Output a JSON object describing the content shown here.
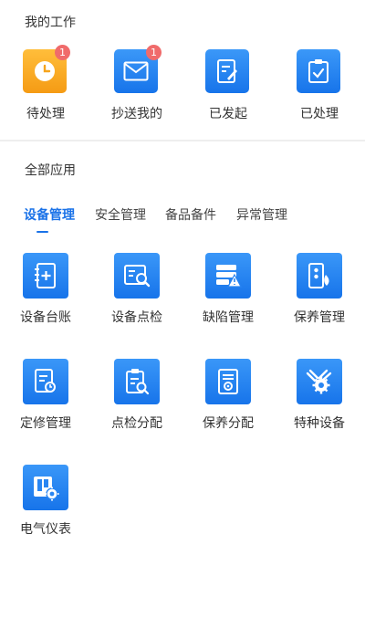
{
  "my_work": {
    "title": "我的工作",
    "items": [
      {
        "label": "待处理",
        "badge": "1",
        "icon": "clock-icon",
        "color": "#f6a41c"
      },
      {
        "label": "抄送我的",
        "badge": "1",
        "icon": "mail-icon",
        "color": "#1e7ff0"
      },
      {
        "label": "已发起",
        "badge": "",
        "icon": "edit-doc-icon",
        "color": "#1e7ff0"
      },
      {
        "label": "已处理",
        "badge": "",
        "icon": "check-clipboard-icon",
        "color": "#1e7ff0"
      }
    ]
  },
  "all_apps": {
    "title": "全部应用",
    "tabs": [
      {
        "label": "设备管理",
        "active": true
      },
      {
        "label": "安全管理",
        "active": false
      },
      {
        "label": "备品备件",
        "active": false
      },
      {
        "label": "异常管理",
        "active": false
      }
    ],
    "apps": [
      {
        "label": "设备台账",
        "icon": "ledger-book-icon"
      },
      {
        "label": "设备点检",
        "icon": "inspection-search-icon"
      },
      {
        "label": "缺陷管理",
        "icon": "defect-warning-icon"
      },
      {
        "label": "保养管理",
        "icon": "maintenance-device-icon"
      },
      {
        "label": "定修管理",
        "icon": "repair-doc-icon"
      },
      {
        "label": "点检分配",
        "icon": "inspection-assign-icon"
      },
      {
        "label": "保养分配",
        "icon": "maintenance-assign-icon"
      },
      {
        "label": "特种设备",
        "icon": "special-equipment-gear-icon"
      },
      {
        "label": "电气仪表",
        "icon": "electrical-meter-icon"
      }
    ]
  }
}
